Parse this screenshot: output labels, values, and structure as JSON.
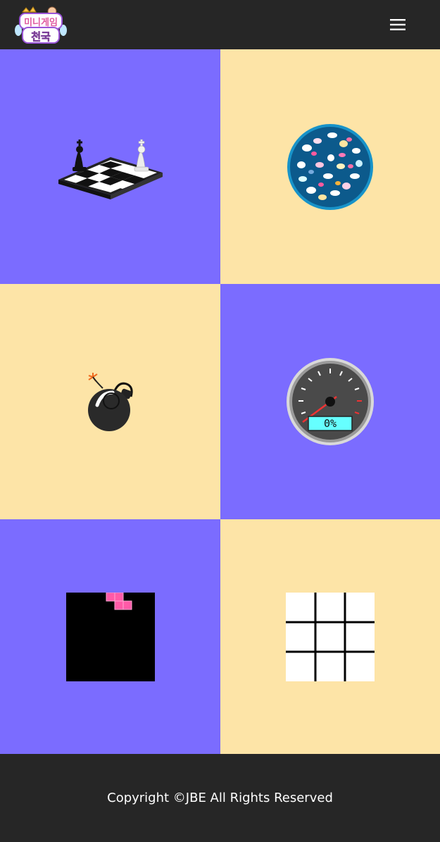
{
  "header": {
    "logo": {
      "line1": "미니게임",
      "line2": "천국"
    },
    "menu_icon": "hamburger-menu-icon"
  },
  "colors": {
    "purple": "#7b6cff",
    "cream": "#fde4a7",
    "dark": "#262626"
  },
  "games": [
    {
      "icon": "chess-icon",
      "color": "#7b6cff"
    },
    {
      "icon": "lottery-ball-icon",
      "color": "#fde4a7"
    },
    {
      "icon": "bomb-icon",
      "color": "#fde4a7"
    },
    {
      "icon": "speedometer-icon",
      "color": "#7b6cff",
      "gauge_text": "0%"
    },
    {
      "icon": "tetris-icon",
      "color": "#7b6cff"
    },
    {
      "icon": "tic-tac-toe-icon",
      "color": "#fde4a7"
    }
  ],
  "footer": {
    "copyright": "Copyright ©JBE All Rights Reserved"
  }
}
